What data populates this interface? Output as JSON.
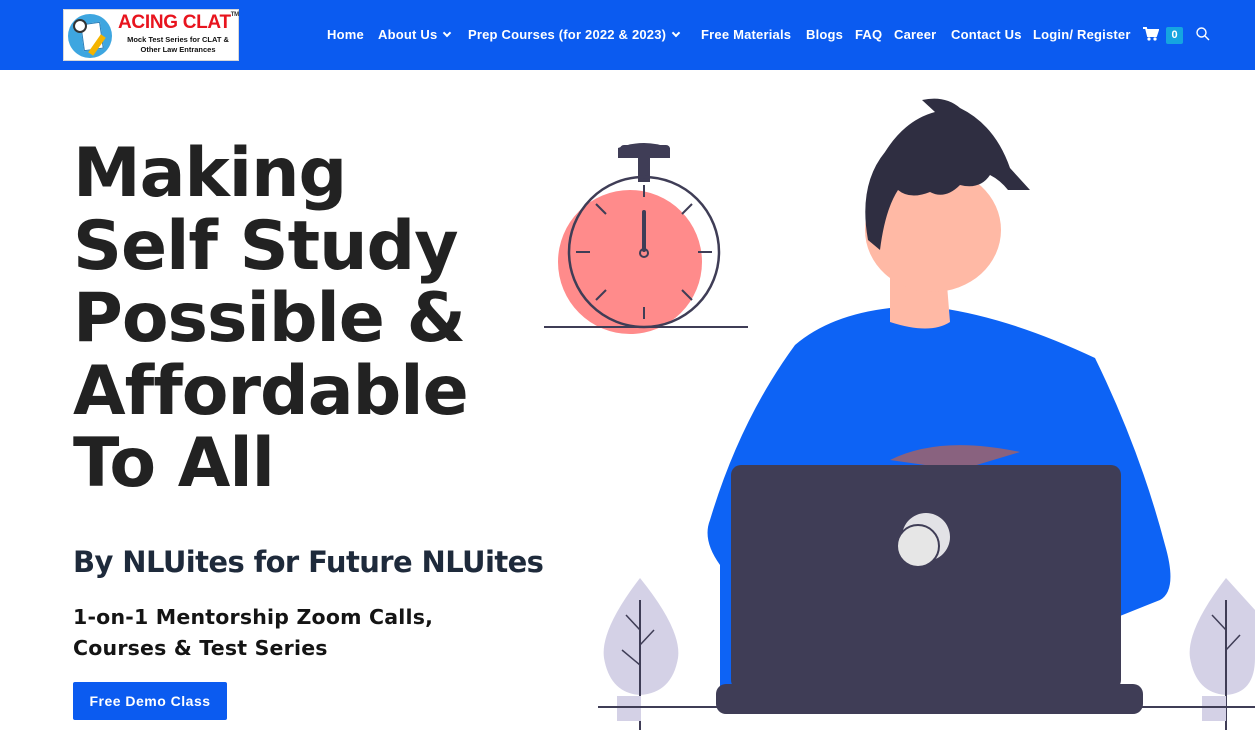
{
  "brand": {
    "name": "ACING CLAT",
    "trademark": "TM",
    "tagline": "Mock Test Series for CLAT & Other Law Entrances"
  },
  "nav": {
    "items": [
      {
        "label": "Home",
        "has_dropdown": false
      },
      {
        "label": "About Us",
        "has_dropdown": true
      },
      {
        "label": "Prep Courses (for 2022 & 2023)",
        "has_dropdown": true
      },
      {
        "label": "Free Materials",
        "has_dropdown": false
      },
      {
        "label": "Blogs",
        "has_dropdown": false
      },
      {
        "label": "FAQ",
        "has_dropdown": false
      },
      {
        "label": "Career",
        "has_dropdown": false
      },
      {
        "label": "Contact Us",
        "has_dropdown": false
      },
      {
        "label": "Login/ Register",
        "has_dropdown": false
      }
    ],
    "cart_count": "0",
    "icons": [
      "cart-icon",
      "search-icon",
      "chevron-down-icon"
    ]
  },
  "hero": {
    "heading_lines": [
      "Making",
      "Self Study",
      "Possible &",
      "Affordable",
      "To All"
    ],
    "subheading": "By NLUites for Future NLUites",
    "description": "1-on-1 Mentorship Zoom Calls, Courses & Test Series",
    "cta_label": "Free Demo Class"
  },
  "colors": {
    "header_bg": "#0b5bf0",
    "button_bg": "#0b5bf0",
    "heading_text": "#222222",
    "illustration_shirt": "#0d63f5",
    "illustration_laptop": "#3f3d56",
    "stopwatch_fill": "#ff8b8b"
  }
}
